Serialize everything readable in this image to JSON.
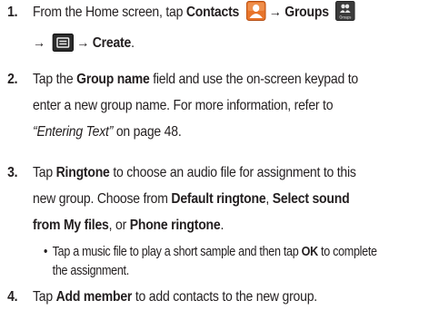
{
  "steps": [
    {
      "number": "1.",
      "line1": {
        "t1": "From the Home screen, tap ",
        "b1": "Contacts",
        "arrow1": "→",
        "b2": "Groups"
      },
      "line2": {
        "arrow1": "→",
        "arrow2": "→",
        "b1": "Create",
        "t1": "."
      },
      "icons": {
        "contacts": "contacts-icon",
        "groups": "groups-icon",
        "groups_label": "Groups",
        "menu": "menu-key-icon"
      }
    },
    {
      "number": "2.",
      "line1": {
        "t1": "Tap the ",
        "b1": "Group name",
        "t2": " field and use the on-screen keypad to"
      },
      "line2": "enter a new group name. For more information, refer to",
      "line3": {
        "i1": "“Entering Text”",
        "t1": " on page 48."
      }
    },
    {
      "number": "3.",
      "line1": {
        "t1": "Tap ",
        "b1": "Ringtone",
        "t2": " to choose an audio file for assignment to this"
      },
      "line2": {
        "t1": "new group. Choose from ",
        "b1": "Default ringtone",
        "t2": ", ",
        "b2": "Select sound"
      },
      "line3": {
        "b1": "from My files",
        "t1": ", or ",
        "b2": "Phone ringtone",
        "t2": "."
      },
      "bullet": {
        "dot": "•",
        "line1": {
          "t1": "Tap a music file to play a short sample and then tap ",
          "b1": "OK",
          "t2": " to complete"
        },
        "line2": "the assignment."
      }
    },
    {
      "number": "4.",
      "line1": {
        "t1": "Tap ",
        "b1": "Add member",
        "t2": " to add contacts to the new group."
      }
    }
  ]
}
